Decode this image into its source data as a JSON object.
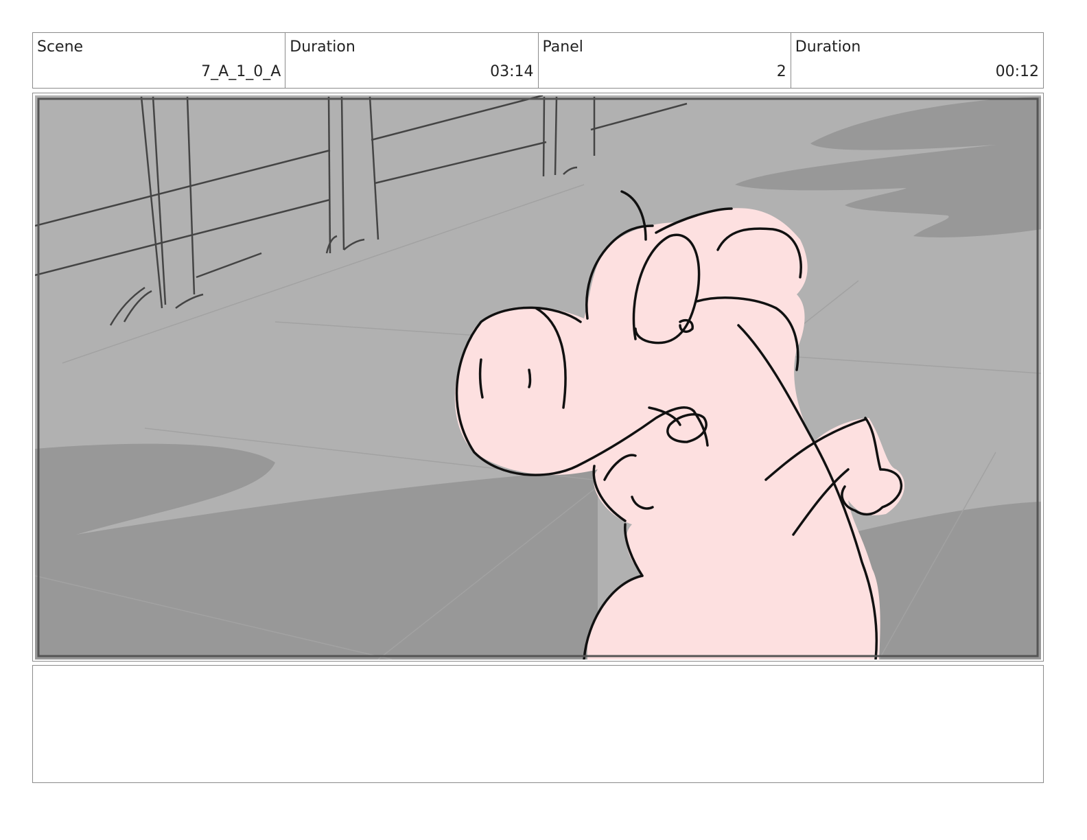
{
  "header": {
    "scene_label": "Scene",
    "scene_value": "7_A_1_0_A",
    "duration_label": "Duration",
    "duration_value": "03:14",
    "panel_label": "Panel",
    "panel_value": "2",
    "panel_duration_label": "Duration",
    "panel_duration_value": "00:12"
  },
  "panel_art": {
    "subject": "pig-character",
    "background_color": "#b1b1b1",
    "shadow_color": "#989898",
    "pig_color": "#fde0e0",
    "line_color": "#111111"
  },
  "notes": {
    "text": ""
  }
}
